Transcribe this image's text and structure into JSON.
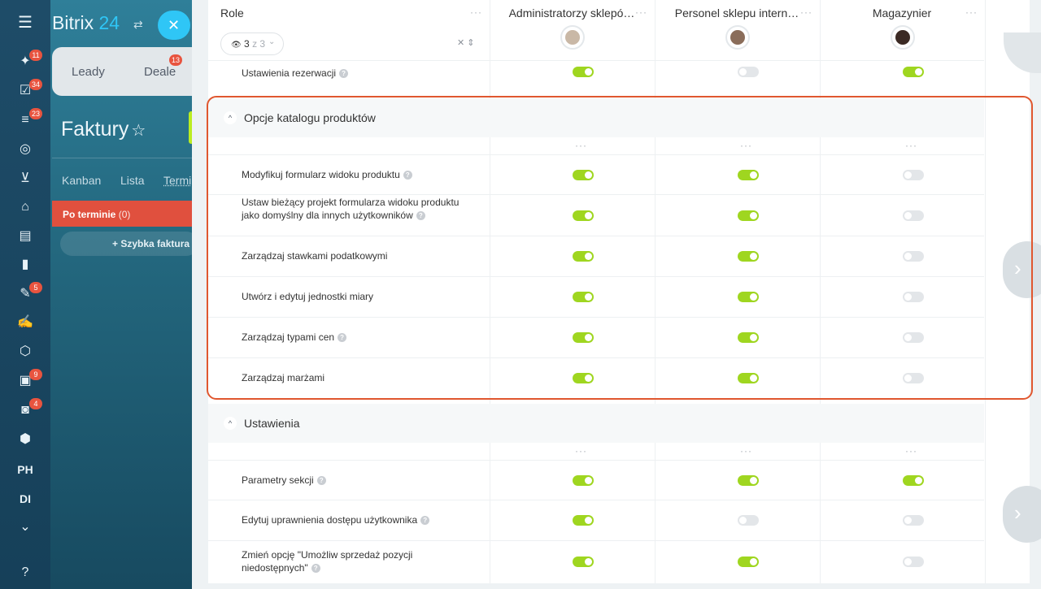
{
  "app": {
    "logo_main": "Bitrix",
    "logo_num": "24",
    "close_label": "✕"
  },
  "rail": {
    "items": [
      {
        "icon": "feed-icon",
        "glyph": "✦",
        "badge": "11"
      },
      {
        "icon": "tasks-icon",
        "glyph": "☑",
        "badge": "34"
      },
      {
        "icon": "crm-icon",
        "glyph": "≡",
        "badge": "23"
      },
      {
        "icon": "target-icon",
        "glyph": "◎",
        "badge": ""
      },
      {
        "icon": "cart-icon",
        "glyph": "⊻",
        "badge": ""
      },
      {
        "icon": "bank-icon",
        "glyph": "⌂",
        "badge": ""
      },
      {
        "icon": "clipboard-icon",
        "glyph": "▤",
        "badge": ""
      },
      {
        "icon": "chart-icon",
        "glyph": "▮",
        "badge": ""
      },
      {
        "icon": "doc-edit-icon",
        "glyph": "✎",
        "badge": "5"
      },
      {
        "icon": "sign-icon",
        "glyph": "✍",
        "badge": ""
      },
      {
        "icon": "hexagon-icon",
        "glyph": "⬡",
        "badge": ""
      },
      {
        "icon": "contact-card-icon",
        "glyph": "▣",
        "badge": "9"
      },
      {
        "icon": "bot-icon",
        "glyph": "◙",
        "badge": "4"
      },
      {
        "icon": "box-icon",
        "glyph": "⬢",
        "badge": ""
      }
    ],
    "text_items": [
      "PH",
      "DI"
    ],
    "more_glyph": "⌄",
    "help_glyph": "?"
  },
  "crm": {
    "tabs": [
      "Leady",
      "Deale"
    ],
    "deal_badge": "13",
    "page_title": "Faktury",
    "views": [
      "Kanban",
      "Lista",
      "Termi"
    ],
    "overdue": {
      "label": "Po terminie",
      "count": "(0)"
    },
    "quick_add": "+ Szybka faktura"
  },
  "header": {
    "role_label": "Role",
    "filter": {
      "shown": "3",
      "total": "z 3"
    },
    "columns": [
      {
        "title": "Administratorzy sklepó…",
        "avatar_color": "#c9b8a6"
      },
      {
        "title": "Personel sklepu intern…",
        "avatar_color": "#8a6d5a"
      },
      {
        "title": "Magazynier",
        "avatar_color": "#3b2a24"
      }
    ]
  },
  "top_row": {
    "label": "Ustawienia rezerwacji",
    "help": true,
    "values": [
      true,
      false,
      true
    ]
  },
  "sections": [
    {
      "title": "Opcje katalogu produktów",
      "rows": [
        {
          "label": "Modyfikuj formularz widoku produktu",
          "help": true,
          "values": [
            true,
            true,
            false
          ]
        },
        {
          "label": "Ustaw bieżący projekt formularza widoku produktu jako domyślny dla innych użytkowników",
          "help": true,
          "values": [
            true,
            true,
            false
          ]
        },
        {
          "label": "Zarządzaj stawkami podatkowymi",
          "help": false,
          "values": [
            true,
            true,
            false
          ]
        },
        {
          "label": "Utwórz i edytuj jednostki miary",
          "help": false,
          "values": [
            true,
            true,
            false
          ]
        },
        {
          "label": "Zarządzaj typami cen",
          "help": true,
          "values": [
            true,
            true,
            false
          ]
        },
        {
          "label": "Zarządzaj marżami",
          "help": false,
          "values": [
            true,
            true,
            false
          ]
        }
      ]
    },
    {
      "title": "Ustawienia",
      "rows": [
        {
          "label": "Parametry sekcji",
          "help": true,
          "values": [
            true,
            true,
            true
          ]
        },
        {
          "label": "Edytuj uprawnienia dostępu użytkownika",
          "help": true,
          "values": [
            true,
            false,
            false
          ]
        },
        {
          "label": "Zmień opcję \"Umożliw sprzedaż pozycji niedostępnych\"",
          "help": true,
          "values": [
            true,
            true,
            false
          ]
        }
      ]
    }
  ],
  "colors": {
    "toggle_on": "#9fd620",
    "toggle_off": "#e3e6e9",
    "highlight": "#e0572f",
    "badge": "#e8543f",
    "accent": "#2fc6f6"
  }
}
